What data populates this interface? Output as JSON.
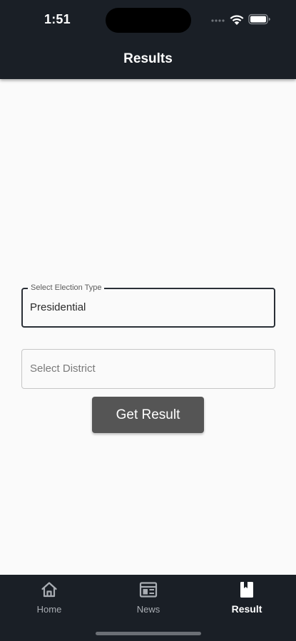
{
  "status_bar": {
    "time": "1:51"
  },
  "app_bar": {
    "title": "Results"
  },
  "form": {
    "election_type": {
      "label": "Select Election Type",
      "value": "Presidential"
    },
    "district": {
      "placeholder": "Select District",
      "value": ""
    },
    "submit_label": "Get Result"
  },
  "bottom_nav": {
    "items": [
      {
        "label": "Home",
        "icon": "home-icon",
        "selected": false
      },
      {
        "label": "News",
        "icon": "newspaper-icon",
        "selected": false
      },
      {
        "label": "Result",
        "icon": "result-book-icon",
        "selected": true
      }
    ]
  },
  "colors": {
    "bar_background": "#1a1f26",
    "page_background": "#fafafa",
    "button_background": "#555555",
    "nav_inactive": "#a9adb3",
    "nav_active": "#ffffff"
  }
}
